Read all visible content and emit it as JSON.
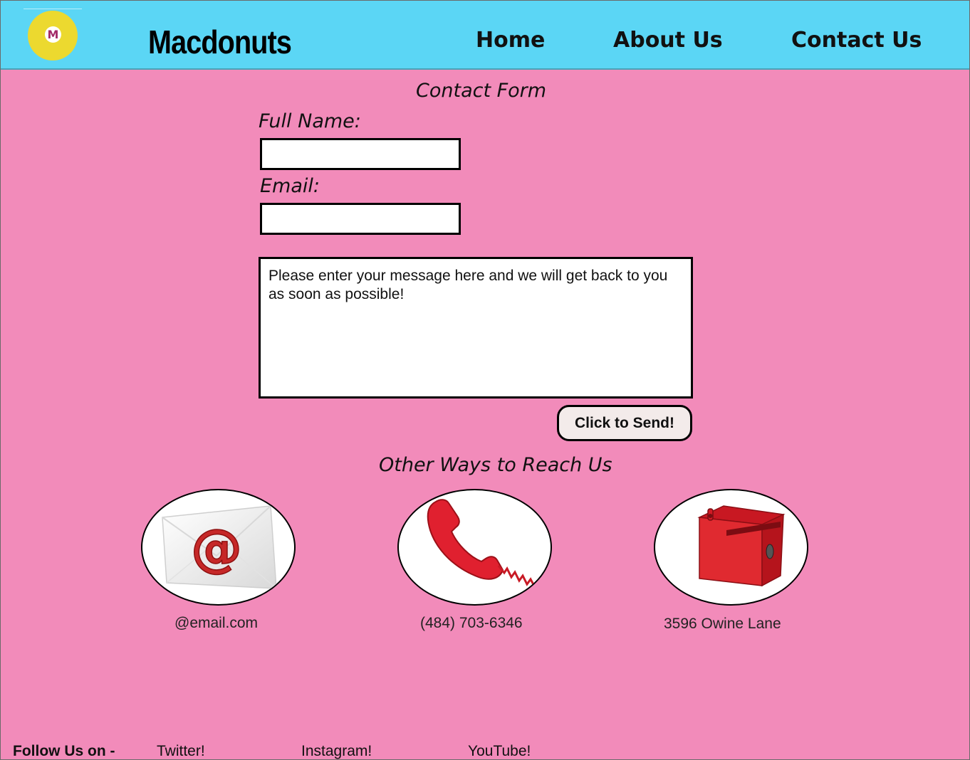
{
  "header": {
    "logo_letter": "M",
    "brand": "Macdonuts",
    "nav": [
      {
        "label": "Home"
      },
      {
        "label": "About Us"
      },
      {
        "label": "Contact Us"
      }
    ]
  },
  "form": {
    "title": "Contact Form",
    "full_name_label": "Full Name:",
    "full_name_value": "",
    "email_label": "Email:",
    "email_value": "",
    "message_placeholder": "Please enter your message here and we will get back to you as soon as possible!",
    "send_label": "Click to Send!"
  },
  "other_ways": {
    "title": "Other Ways to Reach Us",
    "items": [
      {
        "icon": "email-envelope-icon",
        "text": "@email.com"
      },
      {
        "icon": "telephone-icon",
        "text": "(484) 703-6346"
      },
      {
        "icon": "mailbox-icon",
        "text": "3596 Owine Lane"
      }
    ]
  },
  "footer": {
    "follow_label": "Follow Us on -",
    "links": [
      {
        "label": "Twitter!"
      },
      {
        "label": "Instagram!"
      },
      {
        "label": "YouTube!"
      }
    ]
  },
  "colors": {
    "header_bg": "#5bd6f5",
    "page_bg": "#f28bba",
    "logo_yellow": "#ecd92f",
    "logo_letter": "#a22a67",
    "button_bg": "#f3ebea",
    "icon_red": "#d91e2a"
  }
}
